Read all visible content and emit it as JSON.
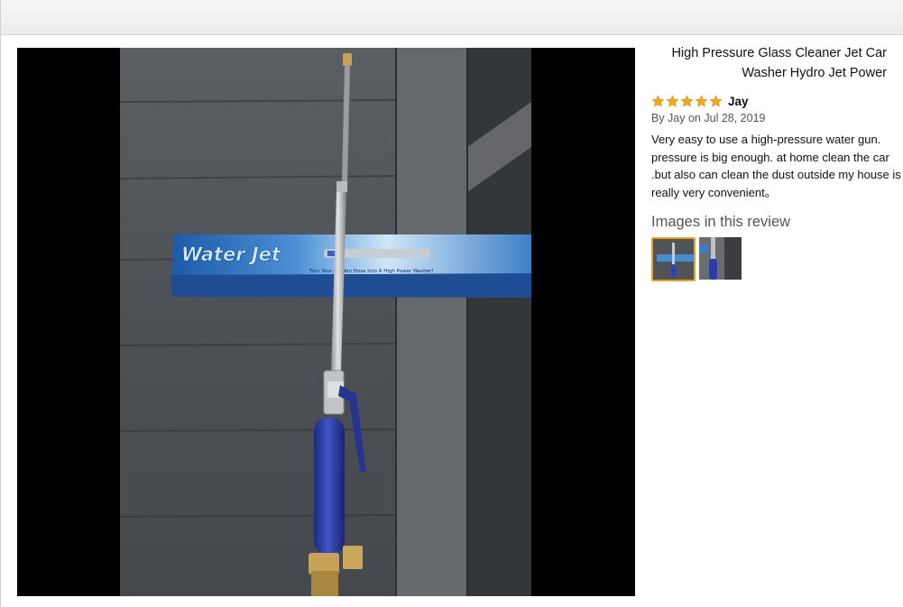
{
  "product": {
    "title": "High Pressure Glass Cleaner Jet Car Washer Hydro Jet Power"
  },
  "photo": {
    "box_text": "Water Jet",
    "box_subtitle": "Turn Your Garden Hose Into A High Power Washer!"
  },
  "review": {
    "rating": 5,
    "rating_max": 5,
    "reviewer": "Jay",
    "byline": "By Jay on Jul 28, 2019",
    "text": "Very easy to use a high-pressure water gun. pressure is big enough. at home clean the car .but also can clean the dust outside my house is really very convenient。",
    "images_heading": "Images in this review",
    "thumbnails": [
      {
        "icon": "washer-wand-photo-thumbnail",
        "selected": true
      },
      {
        "icon": "washer-wand-closeup-thumbnail",
        "selected": false
      }
    ]
  },
  "colors": {
    "star": "#f0a81f",
    "selected_border": "#e7a424",
    "wand_blue": "#2b3ea8"
  }
}
